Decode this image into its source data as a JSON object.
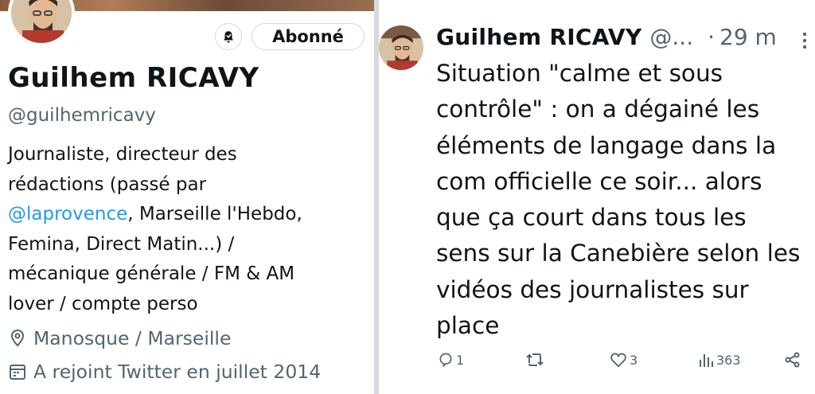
{
  "profile": {
    "name": "Guilhem RICAVY",
    "handle": "@guilhemricavy",
    "follow_label": "Abonné",
    "bio": {
      "line1": "Journaliste, directeur des",
      "line2": "rédactions (passé par",
      "mention": "@laprovence",
      "line3_rest": ", Marseille l'Hebdo,",
      "line4": "Femina, Direct Matin...) /",
      "line5": "mécanique générale / FM & AM",
      "line6": "lover / compte perso"
    },
    "location": "Manosque / Marseille",
    "joined": "A rejoint Twitter en juillet 2014"
  },
  "tweet": {
    "author_name": "Guilhem RICAVY",
    "author_handle": "@...",
    "separator": "·",
    "time": "29 m",
    "lines": [
      "Situation \"calme et sous",
      "contrôle\" : on a dégainé les",
      "éléments de langage dans la",
      "com officielle ce soir... alors",
      "que ça court dans tous les",
      "sens sur la Canebière selon les",
      "vidéos des journalistes sur",
      "place"
    ],
    "replies": "1",
    "retweets": "",
    "likes": "3",
    "views": "363"
  },
  "colors": {
    "accent": "#1d9bf0",
    "muted": "#536471",
    "text": "#0f1419"
  },
  "icons": [
    "bell-icon",
    "location-pin-icon",
    "calendar-icon",
    "more-icon",
    "reply-icon",
    "retweet-icon",
    "like-icon",
    "views-icon",
    "share-icon"
  ]
}
